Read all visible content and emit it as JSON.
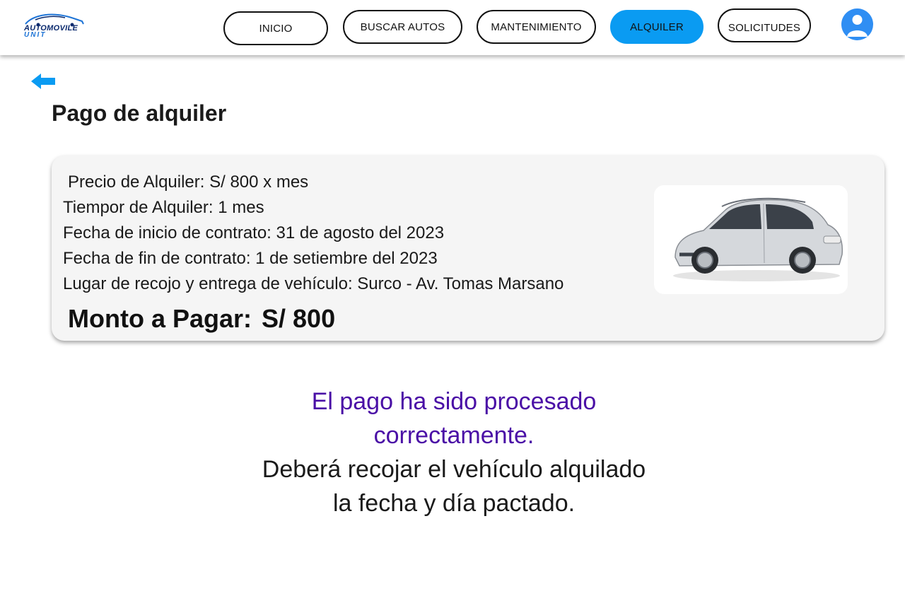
{
  "header": {
    "logo": {
      "line1": "AUTOMOVILE",
      "line2": "UNIT",
      "icon": "car-logo-icon"
    },
    "nav": [
      {
        "label": "INICIO"
      },
      {
        "label": "BUSCAR AUTOS"
      },
      {
        "label": "MANTENIMIENTO"
      },
      {
        "label": "ALQUILER",
        "active": true
      },
      {
        "label": "SOLICITUDES"
      }
    ],
    "profile_icon": "user-avatar-icon"
  },
  "back_icon": "arrow-left-icon",
  "page_title": "Pago de alquiler",
  "rental": {
    "price": "Precio de Alquiler:  S/ 800 x mes",
    "duration": "Tiempor de Alquiler: 1 mes",
    "start": "Fecha de inicio de contrato: 31 de agosto del 2023",
    "end": "Fecha de fin de contrato: 1 de setiembre del 2023",
    "place": "Lugar de recojo y entrega de vehículo: Surco - Av. Tomas Marsano",
    "amount_label": "Monto a Pagar:",
    "amount_value": "S/ 800",
    "car_image": "silver-suv-image"
  },
  "message": {
    "success_line1": "El pago ha sido procesado",
    "success_line2": "correctamente.",
    "info_line1": "Deberá recojar el vehículo alquilado",
    "info_line2": "la fecha y día pactado."
  },
  "colors": {
    "accent": "#0a9bf2",
    "success_text": "#4a0fa6",
    "avatar": "#2f8ef3",
    "logo_dark": "#0b2a6e",
    "logo_light": "#1e74d6"
  }
}
